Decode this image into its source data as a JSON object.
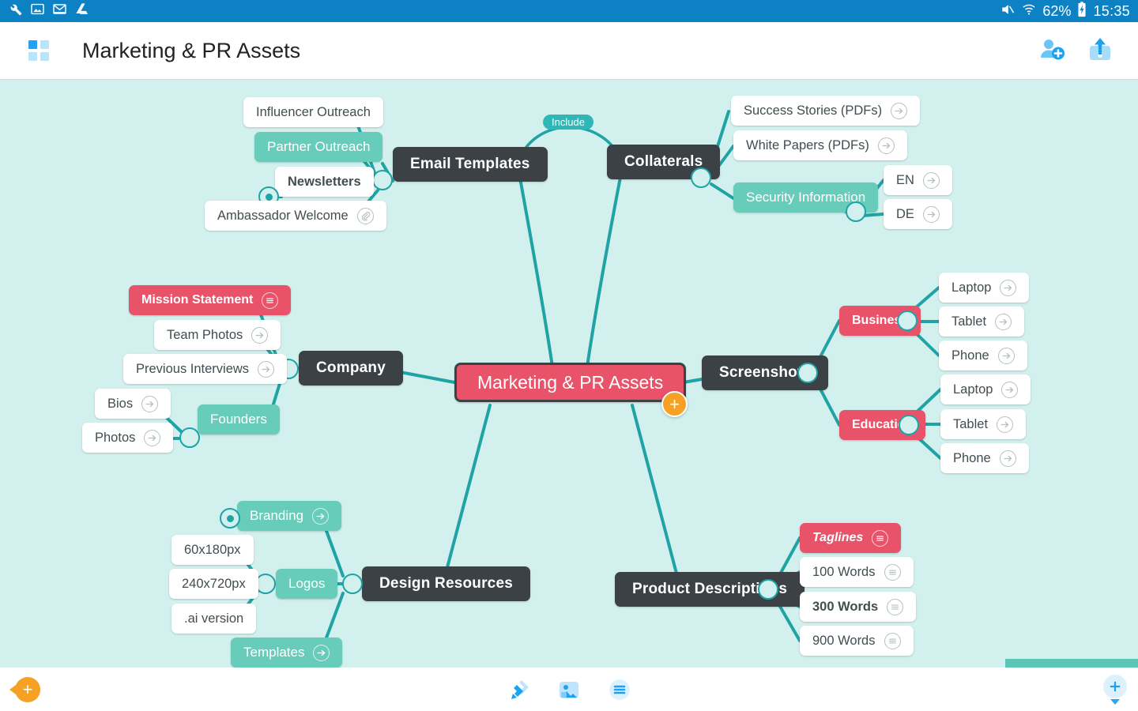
{
  "statusbar": {
    "left_icons": [
      "wrench-icon",
      "photo-icon",
      "gmail-icon",
      "drive-icon"
    ],
    "right_icons": [
      "mute-icon",
      "wifi-icon"
    ],
    "battery_percent": "62%",
    "battery_state": "charging",
    "time": "15:35"
  },
  "appbar": {
    "logo": "four-square-grid-logo",
    "title": "Marketing & PR Assets",
    "actions": [
      {
        "name": "add-collaborator-button",
        "icon": "person-add-icon"
      },
      {
        "name": "share-export-button",
        "icon": "upload-icon"
      }
    ]
  },
  "mindmap": {
    "root": {
      "text": "Marketing & PR Assets",
      "style": "center-selected-pink"
    },
    "relation_label": "Include",
    "branches": [
      {
        "name": "email-templates",
        "text": "Email Templates",
        "children": [
          {
            "text": "Influencer Outreach",
            "style": "white"
          },
          {
            "text": "Partner Outreach",
            "style": "teal"
          },
          {
            "text": "Newsletters",
            "style": "white-bold"
          },
          {
            "text": "Ambassador Welcome",
            "style": "white",
            "icon": "attachment-icon"
          }
        ]
      },
      {
        "name": "collaterals",
        "text": "Collaterals",
        "children": [
          {
            "text": "Success Stories (PDFs)",
            "style": "white",
            "icon": "arrow-right-icon"
          },
          {
            "text": "White Papers (PDFs)",
            "style": "white",
            "icon": "arrow-right-icon"
          },
          {
            "text": "Security Information",
            "style": "teal",
            "children": [
              {
                "text": "EN",
                "style": "white",
                "icon": "arrow-right-icon"
              },
              {
                "text": "DE",
                "style": "white",
                "icon": "arrow-right-icon"
              }
            ]
          }
        ]
      },
      {
        "name": "company",
        "text": "Company",
        "children": [
          {
            "text": "Mission Statement",
            "style": "pink",
            "icon": "note-icon"
          },
          {
            "text": "Team Photos",
            "style": "white",
            "icon": "arrow-right-icon"
          },
          {
            "text": "Previous Interviews",
            "style": "white",
            "icon": "arrow-right-icon"
          },
          {
            "text": "Founders",
            "style": "teal",
            "children": [
              {
                "text": "Bios",
                "style": "white",
                "icon": "arrow-right-icon"
              },
              {
                "text": "Photos",
                "style": "white",
                "icon": "arrow-right-icon"
              }
            ]
          }
        ]
      },
      {
        "name": "screenshots",
        "text": "Screenshots",
        "children": [
          {
            "text": "Business",
            "style": "pink",
            "children": [
              {
                "text": "Laptop",
                "style": "white",
                "icon": "arrow-right-icon"
              },
              {
                "text": "Tablet",
                "style": "white",
                "icon": "arrow-right-icon"
              },
              {
                "text": "Phone",
                "style": "white",
                "icon": "arrow-right-icon"
              }
            ]
          },
          {
            "text": "Education",
            "style": "pink",
            "children": [
              {
                "text": "Laptop",
                "style": "white",
                "icon": "arrow-right-icon"
              },
              {
                "text": "Tablet",
                "style": "white",
                "icon": "arrow-right-icon"
              },
              {
                "text": "Phone",
                "style": "white",
                "icon": "arrow-right-icon"
              }
            ]
          }
        ]
      },
      {
        "name": "design-resources",
        "text": "Design Resources",
        "children": [
          {
            "text": "Branding",
            "style": "teal",
            "icon": "arrow-right-icon"
          },
          {
            "text": "Logos",
            "style": "teal",
            "children": [
              {
                "text": "60x180px",
                "style": "white"
              },
              {
                "text": "240x720px",
                "style": "white"
              },
              {
                "text": ".ai version",
                "style": "white"
              }
            ]
          },
          {
            "text": "Templates",
            "style": "teal",
            "icon": "arrow-right-icon"
          }
        ]
      },
      {
        "name": "product-descriptions",
        "text": "Product Descriptions",
        "children": [
          {
            "text": "Taglines",
            "style": "pink-italic",
            "icon": "note-icon"
          },
          {
            "text": "100 Words",
            "style": "white",
            "icon": "note-icon"
          },
          {
            "text": "300 Words",
            "style": "white-bold",
            "icon": "note-icon"
          },
          {
            "text": "900 Words",
            "style": "white",
            "icon": "note-icon"
          }
        ]
      }
    ],
    "add_child_button": "+"
  },
  "bottombar": {
    "add_button": "+",
    "tools": [
      {
        "name": "format-brush-tool",
        "icon": "brush-icon"
      },
      {
        "name": "insert-image-tool",
        "icon": "image-icon"
      },
      {
        "name": "outline-menu-tool",
        "icon": "list-icon"
      }
    ],
    "zoom_in": "+"
  },
  "colors": {
    "status_bar": "#0c81c4",
    "canvas_bg": "#d2f0ee",
    "branch_node": "#3b4145",
    "teal_node": "#68ccba",
    "pink_node": "#e8536a",
    "edge": "#1fa3a5",
    "accent_orange": "#f6a124",
    "accent_blue": "#29a8f0"
  }
}
